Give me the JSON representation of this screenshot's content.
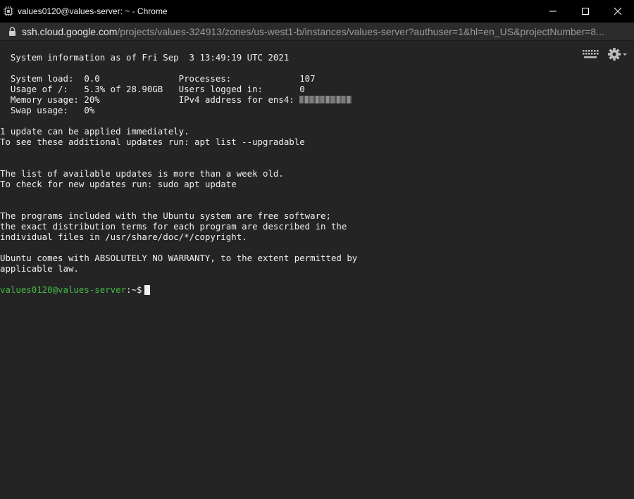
{
  "window": {
    "title": "values0120@values-server: ~ - Chrome"
  },
  "address": {
    "host": "ssh.cloud.google.com",
    "path": "/projects/values-324913/zones/us-west1-b/instances/values-server?authuser=1&hl=en_US&projectNumber=8..."
  },
  "terminal": {
    "lines": [
      "  System information as of Fri Sep  3 13:49:19 UTC 2021",
      "",
      "  System load:  0.0               Processes:             107",
      "  Usage of /:   5.3% of 28.90GB   Users logged in:       0",
      "  Memory usage: 20%               IPv4 address for ens4: ",
      "  Swap usage:   0%",
      "",
      "1 update can be applied immediately.",
      "To see these additional updates run: apt list --upgradable",
      "",
      "",
      "The list of available updates is more than a week old.",
      "To check for new updates run: sudo apt update",
      "",
      "",
      "The programs included with the Ubuntu system are free software;",
      "the exact distribution terms for each program are described in the",
      "individual files in /usr/share/doc/*/copyright.",
      "",
      "Ubuntu comes with ABSOLUTELY NO WARRANTY, to the extent permitted by",
      "applicable law."
    ],
    "redacted_line_index": 4,
    "prompt": {
      "user_host": "values0120@values-server",
      "path": ":~$"
    }
  },
  "icons": {
    "app": "terminal-chip-icon",
    "lock": "lock-icon",
    "keyboard": "keyboard-icon",
    "settings": "gear-icon"
  },
  "colors": {
    "terminal_bg": "#242424",
    "prompt_user": "#45b945",
    "text": "#f0f0f0"
  }
}
